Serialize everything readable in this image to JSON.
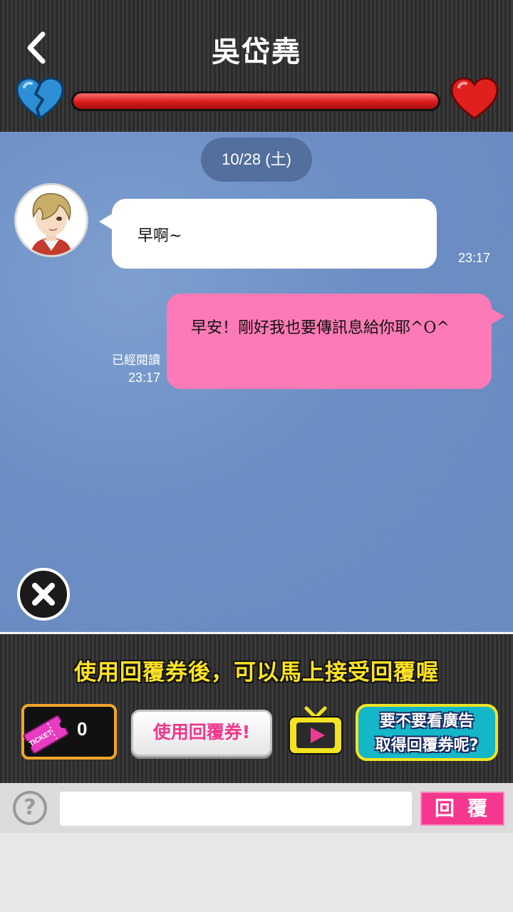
{
  "header": {
    "title": "吳岱堯",
    "back_icon": "chevron-left-icon",
    "left_icon": "broken-heart-icon",
    "right_icon": "heart-icon",
    "affection_level": 1.0,
    "affection_color": "#d71b1b"
  },
  "chat": {
    "date_label": "10/28 (土)",
    "messages": [
      {
        "from": "contact",
        "text": "早啊~",
        "time": "23:17"
      },
      {
        "from": "me",
        "text": "早安！剛好我也要傳訊息給你耶^O^",
        "read_label": "已經閱讀",
        "time": "23:17"
      }
    ]
  },
  "ticket_panel": {
    "promo_text": "使用回覆券後，可以馬上接受回覆喔",
    "ticket_label": "TICKET",
    "ticket_count": "0",
    "use_ticket_label": "使用回覆券!",
    "watch_ad_line1": "要不要看廣告",
    "watch_ad_line2": "取得回覆券呢?"
  },
  "input_bar": {
    "help_label": "?",
    "input_value": "",
    "reply_label": "回覆"
  },
  "colors": {
    "chat_bg": "#6c8ec4",
    "outgoing_bubble": "#fc7ab5",
    "incoming_bubble": "#ffffff",
    "reply_button": "#f5388e",
    "promo_text": "#ffe324"
  }
}
